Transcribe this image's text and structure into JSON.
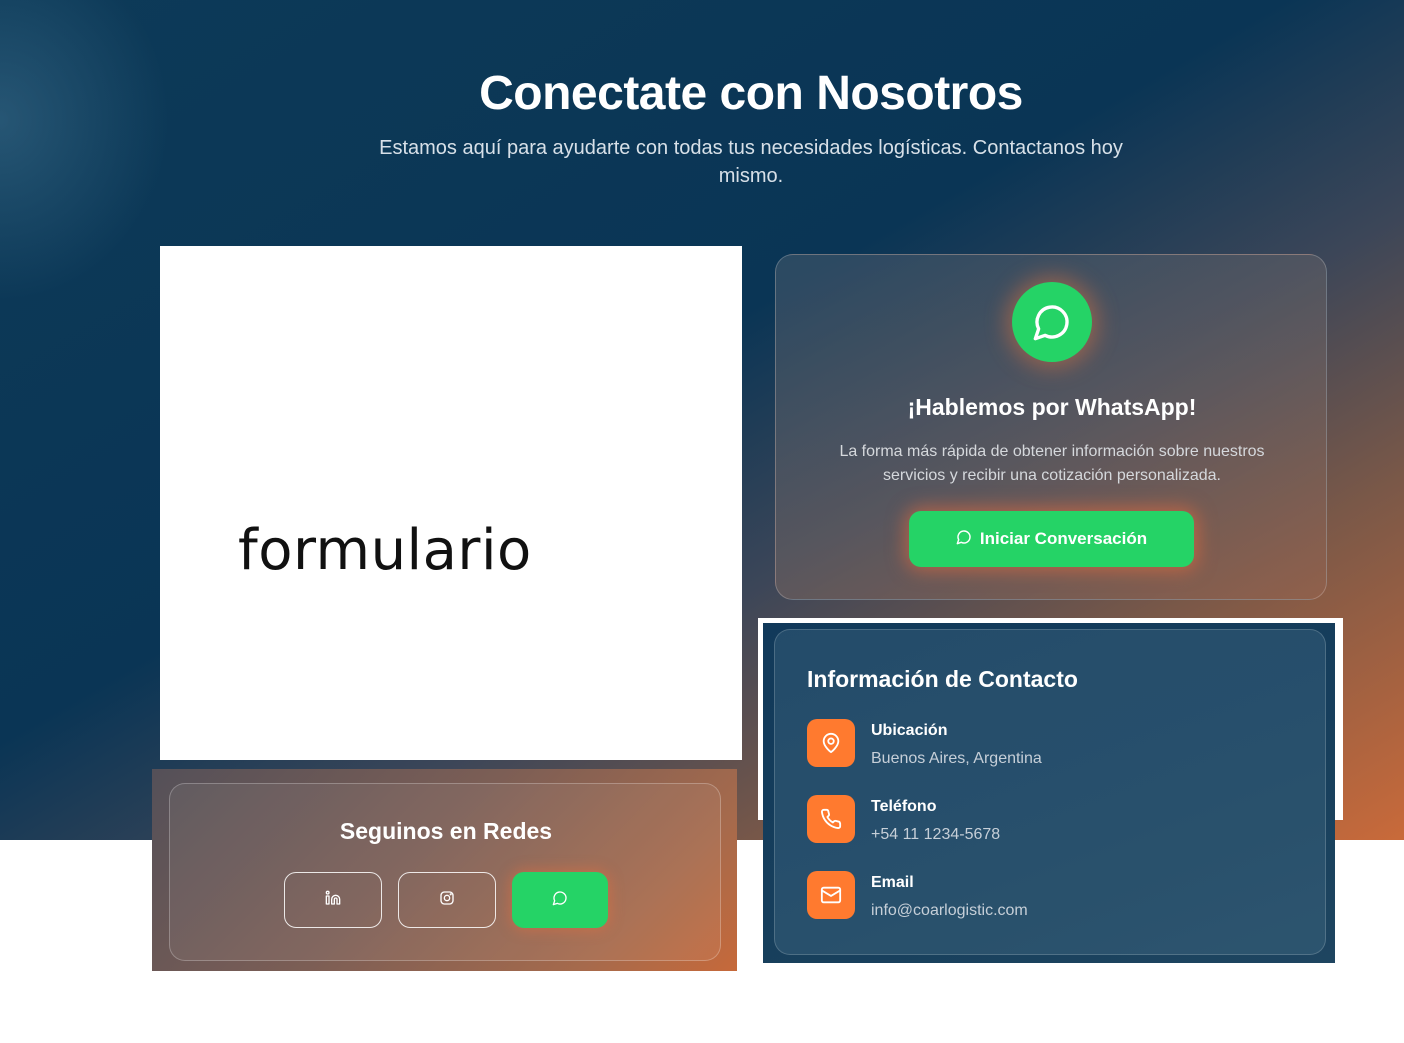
{
  "header": {
    "title": "Conectate con Nosotros",
    "subtitle": "Estamos aquí para ayudarte con todas tus necesidades logísticas. Contactanos hoy mismo."
  },
  "form_placeholder": {
    "label": "formulario"
  },
  "whatsapp_card": {
    "icon": "whatsapp-icon",
    "title": "¡Hablemos por WhatsApp!",
    "description": "La forma más rápida de obtener información sobre nuestros servicios y recibir una cotización personalizada.",
    "button_label": "Iniciar Conversación",
    "button_color": "#25d366"
  },
  "social": {
    "title": "Seguinos en Redes",
    "buttons": [
      {
        "icon": "linkedin-icon"
      },
      {
        "icon": "instagram-icon"
      },
      {
        "icon": "whatsapp-icon"
      }
    ]
  },
  "contact_info": {
    "title": "Información de Contacto",
    "items": [
      {
        "icon": "map-pin-icon",
        "label": "Ubicación",
        "value": "Buenos Aires, Argentina"
      },
      {
        "icon": "phone-icon",
        "label": "Teléfono",
        "value": "+54 11 1234-5678"
      },
      {
        "icon": "mail-icon",
        "label": "Email",
        "value": "info@coarlogistic.com"
      }
    ],
    "icon_color": "#ff7a2f"
  },
  "colors": {
    "hero_dark": "#0a3555",
    "hero_accent": "#c96a3a",
    "whatsapp_green": "#25d366",
    "orange_accent": "#ff7a2f"
  }
}
